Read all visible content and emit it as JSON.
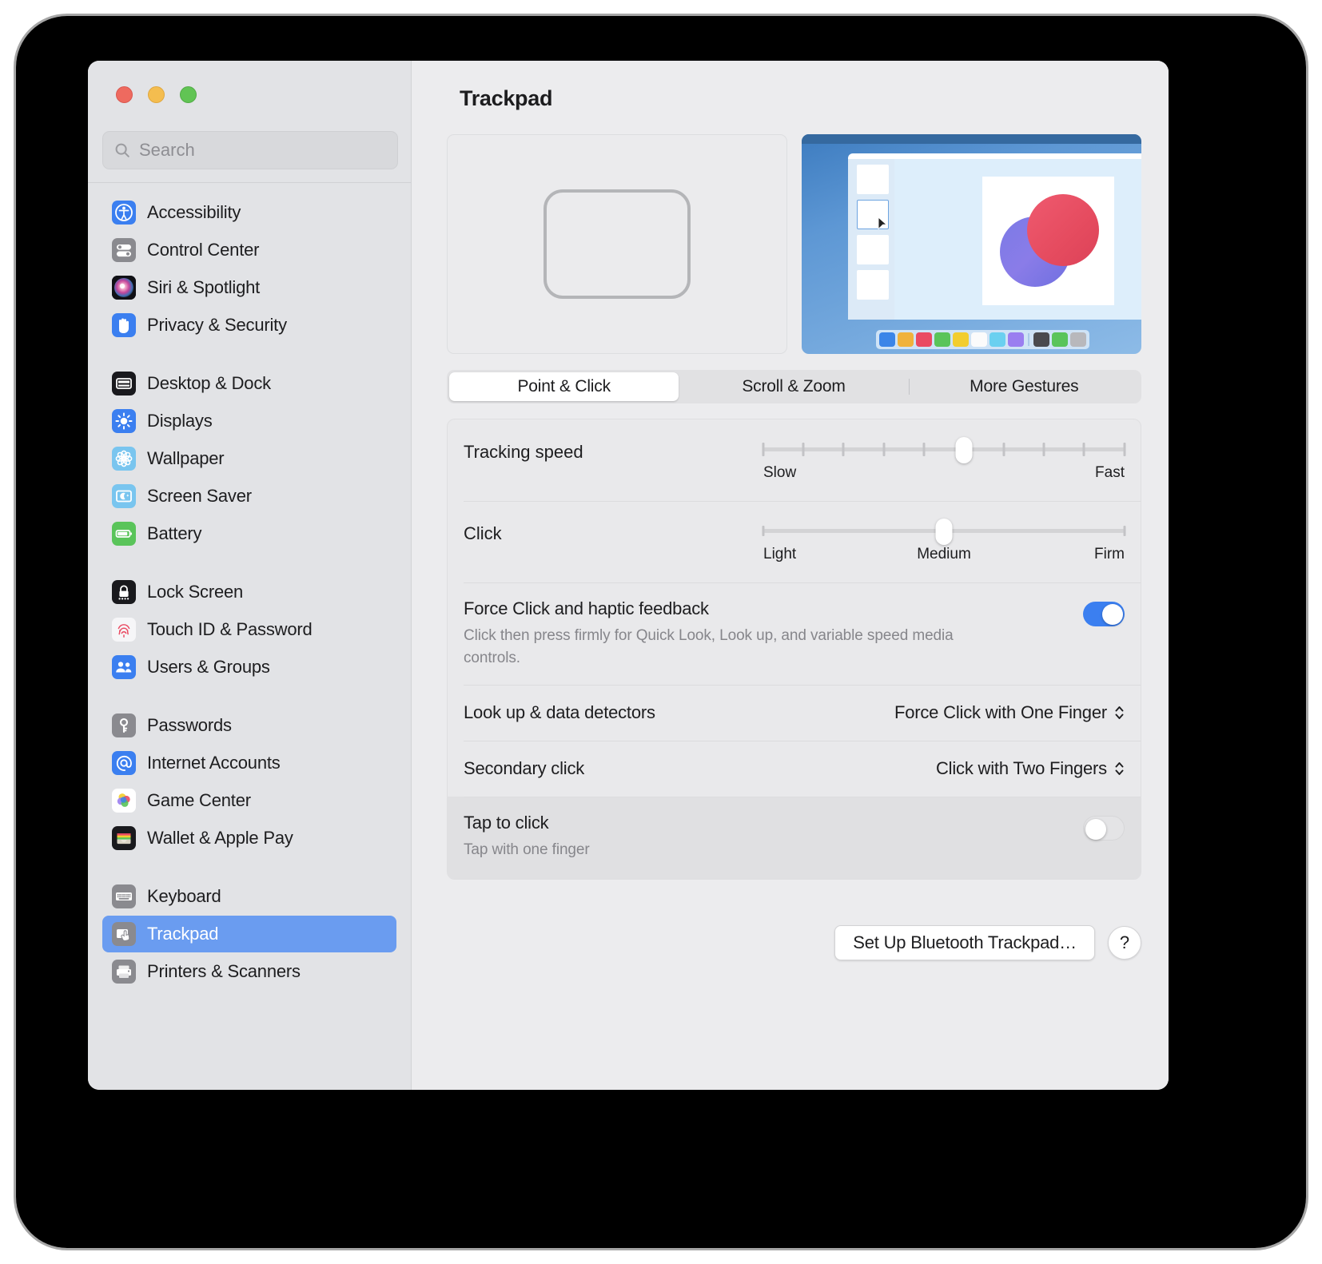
{
  "window": {
    "traffic_lights": [
      "close",
      "minimize",
      "zoom"
    ],
    "colors": {
      "close": "#ee6a5f",
      "minimize": "#f4bd4f",
      "zoom": "#61c454",
      "accent_blue": "#3b7ff0",
      "selection_blue": "#6a9cf0"
    }
  },
  "search": {
    "placeholder": "Search",
    "value": "",
    "icon": "search-icon"
  },
  "sidebar": {
    "groups": [
      {
        "items": [
          {
            "label": "Accessibility",
            "icon": "accessibility-icon",
            "selected": false
          },
          {
            "label": "Control Center",
            "icon": "control-center-icon",
            "selected": false
          },
          {
            "label": "Siri & Spotlight",
            "icon": "siri-icon",
            "selected": false
          },
          {
            "label": "Privacy & Security",
            "icon": "privacy-hand-icon",
            "selected": false
          }
        ]
      },
      {
        "items": [
          {
            "label": "Desktop & Dock",
            "icon": "desktop-dock-icon",
            "selected": false
          },
          {
            "label": "Displays",
            "icon": "displays-brightness-icon",
            "selected": false
          },
          {
            "label": "Wallpaper",
            "icon": "wallpaper-flower-icon",
            "selected": false
          },
          {
            "label": "Screen Saver",
            "icon": "screen-saver-moon-icon",
            "selected": false
          },
          {
            "label": "Battery",
            "icon": "battery-icon",
            "selected": false
          }
        ]
      },
      {
        "items": [
          {
            "label": "Lock Screen",
            "icon": "lock-screen-icon",
            "selected": false
          },
          {
            "label": "Touch ID & Password",
            "icon": "touch-id-fingerprint-icon",
            "selected": false
          },
          {
            "label": "Users & Groups",
            "icon": "users-groups-icon",
            "selected": false
          }
        ]
      },
      {
        "items": [
          {
            "label": "Passwords",
            "icon": "passwords-key-icon",
            "selected": false
          },
          {
            "label": "Internet Accounts",
            "icon": "internet-accounts-at-icon",
            "selected": false
          },
          {
            "label": "Game Center",
            "icon": "game-center-icon",
            "selected": false
          },
          {
            "label": "Wallet & Apple Pay",
            "icon": "wallet-icon",
            "selected": false
          }
        ]
      },
      {
        "items": [
          {
            "label": "Keyboard",
            "icon": "keyboard-icon",
            "selected": false
          },
          {
            "label": "Trackpad",
            "icon": "trackpad-icon",
            "selected": true
          },
          {
            "label": "Printers & Scanners",
            "icon": "printer-icon",
            "selected": false
          }
        ]
      }
    ]
  },
  "header": {
    "title": "Trackpad"
  },
  "preview": {
    "trackpad_illustration": "trackpad-outline-shape",
    "video_illustration": "point-and-click-demo-video",
    "palette_colors": [
      "#3b85e8",
      "#f0b23c",
      "#ea4a62",
      "#5ac45a",
      "#f2cd2f",
      "#fbfbfb",
      "#6ad0f0",
      "#9a7ef0",
      "#4a4a4e",
      "#5ac45a",
      "#b8b8bc"
    ]
  },
  "tabs": [
    {
      "label": "Point & Click",
      "active": true
    },
    {
      "label": "Scroll & Zoom",
      "active": false
    },
    {
      "label": "More Gestures",
      "active": false
    }
  ],
  "settings": {
    "tracking_speed": {
      "label": "Tracking speed",
      "min_label": "Slow",
      "max_label": "Fast",
      "ticks": 9,
      "value_index": 5,
      "value_percent": 55
    },
    "click": {
      "label": "Click",
      "min_label": "Light",
      "mid_label": "Medium",
      "max_label": "Firm",
      "value_percent": 50
    },
    "force_click": {
      "label": "Force Click and haptic feedback",
      "description": "Click then press firmly for Quick Look, Look up, and variable speed media controls.",
      "enabled": true,
      "state_text": "on"
    },
    "look_up": {
      "label": "Look up & data detectors",
      "value": "Force Click with One Finger"
    },
    "secondary_click": {
      "label": "Secondary click",
      "value": "Click with Two Fingers"
    },
    "tap_to_click": {
      "label": "Tap to click",
      "description": "Tap with one finger",
      "enabled": false,
      "state_text": "off",
      "highlighted": true
    }
  },
  "footer": {
    "setup_button": "Set Up Bluetooth Trackpad…",
    "help_button": "?"
  }
}
